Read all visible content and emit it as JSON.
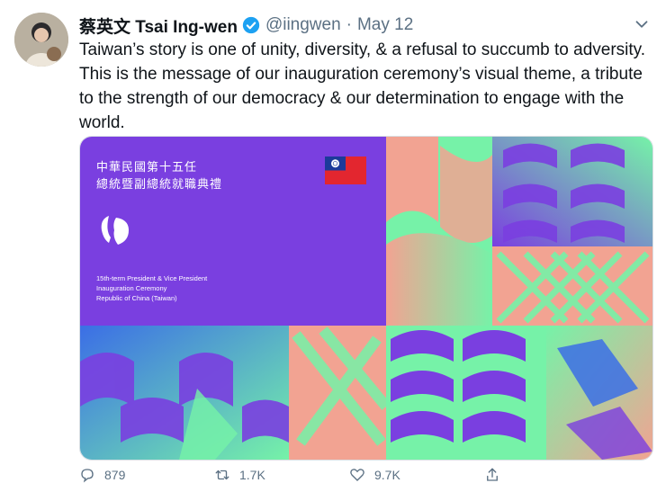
{
  "tweet": {
    "author_name": "蔡英文 Tsai Ing-wen",
    "handle": "@iingwen",
    "separator": "·",
    "date": "May 12",
    "text": "Taiwan’s story is one of unity, diversity, & a refusal to succumb to adversity. This is the message of our inauguration ceremony’s visual theme, a tribute to the strength of our democracy & our determination to engage with the world."
  },
  "media": {
    "title_zh_line1": "中華民國第十五任",
    "title_zh_line2": "總統暨副總統就職典禮",
    "subtitle_en_line1": "15th-term President & Vice President",
    "subtitle_en_line2": "Inauguration Ceremony",
    "subtitle_en_line3": "Republic of China (Taiwan)"
  },
  "actions": {
    "reply_count": "879",
    "retweet_count": "1.7K",
    "like_count": "9.7K"
  },
  "colors": {
    "purple": "#7a3fe0",
    "green": "#76f2a8",
    "salmon": "#f2a392",
    "blue": "#3b6ee6",
    "flag_red": "#e3262f",
    "flag_blue": "#1c3a9a",
    "verified_blue": "#1da1f2"
  },
  "icons": [
    "verified-badge-icon",
    "chevron-down-icon",
    "reply-icon",
    "retweet-icon",
    "like-icon",
    "share-icon"
  ]
}
